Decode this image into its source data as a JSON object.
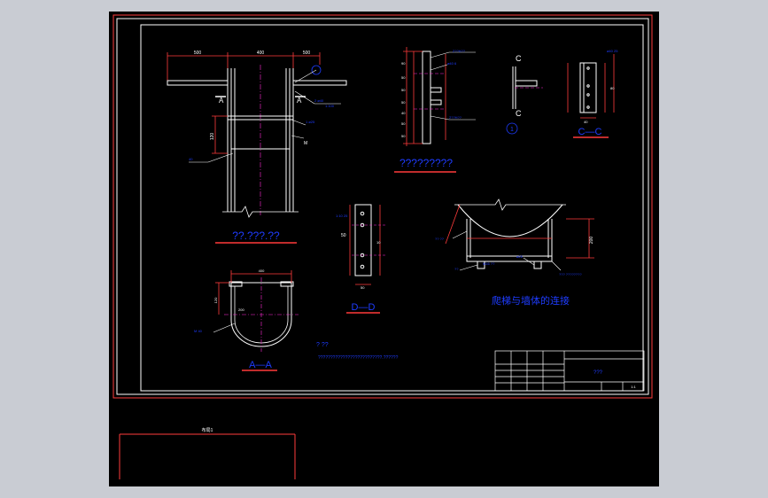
{
  "viewer": {
    "background": "#000000",
    "frame_color": "#ff3b3b",
    "line_color": "#ffffff",
    "dim_color": "#ff3b3b",
    "text_color": "#1e3cff",
    "center_color": "#ff2bd6",
    "annotation_color": "#4f7bff"
  },
  "views": {
    "elevation": {
      "caption": "??.???.??",
      "dims_top": [
        "500",
        "400",
        "500"
      ],
      "dim_side": "120",
      "section_marks": [
        "A",
        "A"
      ],
      "callouts": [
        "2 ⌀40",
        "1:100",
        "1 ⌀25",
        "40",
        "M"
      ]
    },
    "side_detail": {
      "caption": "?????????",
      "labels_right": [
        "2??H??",
        "⌀40 6",
        "2??H??"
      ],
      "dims_left": [
        "90",
        "50",
        "50",
        "50",
        "40",
        "50",
        "50"
      ]
    },
    "section_c": {
      "marks": [
        "C",
        "C"
      ],
      "detail_no": "1"
    },
    "section_cc": {
      "caption": "C—C",
      "dims": [
        "80",
        "40"
      ],
      "label": "⌀40 25"
    },
    "section_dd": {
      "caption": "D—D",
      "label": "1:10 25",
      "dims_left": [
        "50",
        "10"
      ],
      "dim_bottom": "50"
    },
    "section_aa": {
      "caption": "A—A",
      "dim_top": "400",
      "dim_left": "120",
      "callout": "M 40",
      "inner_label": "200"
    },
    "connection": {
      "caption": "爬梯与墙体的连接",
      "dim_right": "200",
      "labels": [
        "?? ??",
        "M16 ??",
        "⌀25",
        "??",
        "??? ????????"
      ]
    }
  },
  "notes": {
    "heading": "? ??",
    "body": "??????????????????????????.??????"
  },
  "title_block": {
    "name": "???",
    "scale": "1:1"
  },
  "layout_tab": {
    "label": "布局1"
  }
}
